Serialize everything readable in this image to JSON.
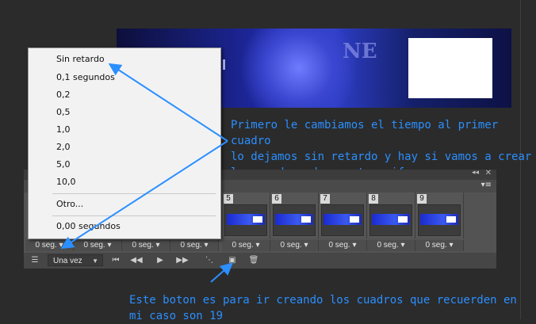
{
  "banner": {
    "logo_text": "II",
    "nerv_text": "NE"
  },
  "annotations": {
    "note_top_lines": [
      "Primero le cambiamos el tiempo al primer cuadro",
      "lo dejamos sin retardo y hay si vamos a crear",
      "los cuadros de nuestro gif"
    ],
    "note_bottom": "Este boton es para ir creando los cuadros que recuerden en mi caso son 19"
  },
  "dropdown": {
    "items": [
      "Sin retardo",
      "0,1 segundos",
      "0,2",
      "0,5",
      "1,0",
      "2,0",
      "5,0",
      "10,0"
    ],
    "other": "Otro...",
    "current": "0,00 segundos"
  },
  "panel": {
    "collapse_icon": "double-chevron-icon",
    "close_icon": "close-icon",
    "menu_icon": "panel-menu-icon",
    "frames": [
      {
        "num": "5",
        "delay": "0 seg."
      },
      {
        "num": "6",
        "delay": "0 seg."
      },
      {
        "num": "7",
        "delay": "0 seg."
      },
      {
        "num": "8",
        "delay": "0 seg."
      },
      {
        "num": "9",
        "delay": "0 seg."
      }
    ],
    "hidden_delays": [
      "0 seg.",
      "0 seg.",
      "0 seg.",
      "0 seg."
    ],
    "loop_label": "Una vez"
  },
  "colors": {
    "annotation": "#2b8fff",
    "panel": "#535353"
  }
}
